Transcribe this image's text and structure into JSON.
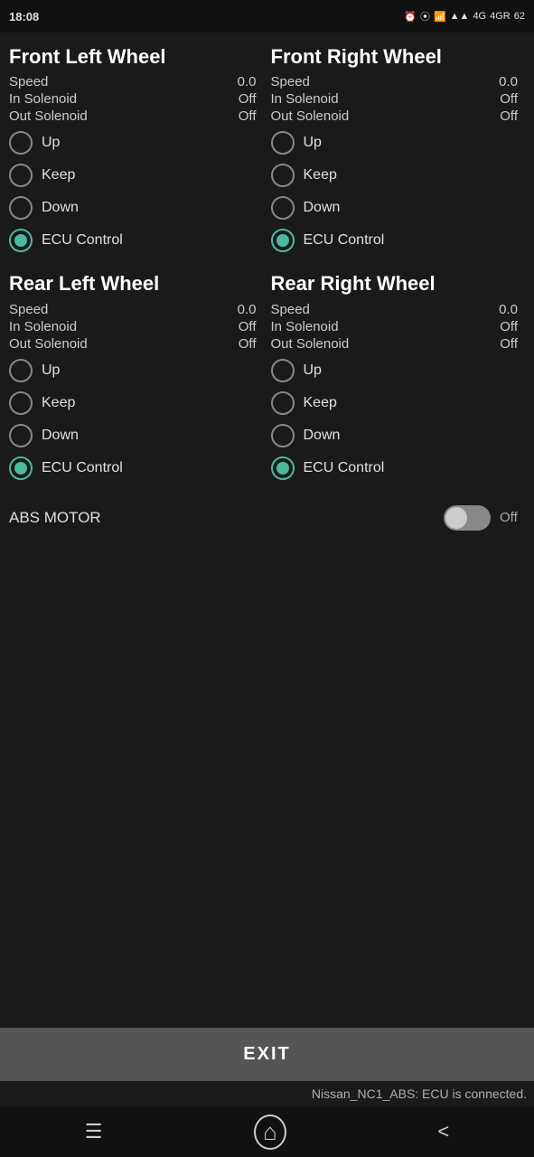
{
  "statusBar": {
    "time": "18:08",
    "rightIcons": "⏰ ⓑ 📶 ᯤ 4G 4GR 62%"
  },
  "frontLeft": {
    "title": "Front Left Wheel",
    "speed": {
      "label": "Speed",
      "value": "0.0"
    },
    "inSolenoid": {
      "label": "In Solenoid",
      "value": "Off"
    },
    "outSolenoid": {
      "label": "Out Solenoid",
      "value": "Off"
    },
    "options": [
      "Up",
      "Keep",
      "Down",
      "ECU Control"
    ],
    "selected": "ECU Control"
  },
  "frontRight": {
    "title": "Front Right Wheel",
    "speed": {
      "label": "Speed",
      "value": "0.0"
    },
    "inSolenoid": {
      "label": "In Solenoid",
      "value": "Off"
    },
    "outSolenoid": {
      "label": "Out Solenoid",
      "value": "Off"
    },
    "options": [
      "Up",
      "Keep",
      "Down",
      "ECU Control"
    ],
    "selected": "ECU Control"
  },
  "rearLeft": {
    "title": "Rear Left Wheel",
    "speed": {
      "label": "Speed",
      "value": "0.0"
    },
    "inSolenoid": {
      "label": "In Solenoid",
      "value": "Off"
    },
    "outSolenoid": {
      "label": "Out Solenoid",
      "value": "Off"
    },
    "options": [
      "Up",
      "Keep",
      "Down",
      "ECU Control"
    ],
    "selected": "ECU Control"
  },
  "rearRight": {
    "title": "Rear Right Wheel",
    "speed": {
      "label": "Speed",
      "value": "0.0"
    },
    "inSolenoid": {
      "label": "In Solenoid",
      "value": "Off"
    },
    "outSolenoid": {
      "label": "Out Solenoid",
      "value": "Off"
    },
    "options": [
      "Up",
      "Keep",
      "Down",
      "ECU Control"
    ],
    "selected": "ECU Control"
  },
  "absMotor": {
    "label": "ABS MOTOR",
    "state": "Off",
    "toggleOn": false
  },
  "exitButton": {
    "label": "EXIT"
  },
  "statusMessage": "Nissan_NC1_ABS: ECU is connected.",
  "navBar": {
    "menuIcon": "☰",
    "homeIcon": "⌂",
    "backIcon": "<"
  }
}
